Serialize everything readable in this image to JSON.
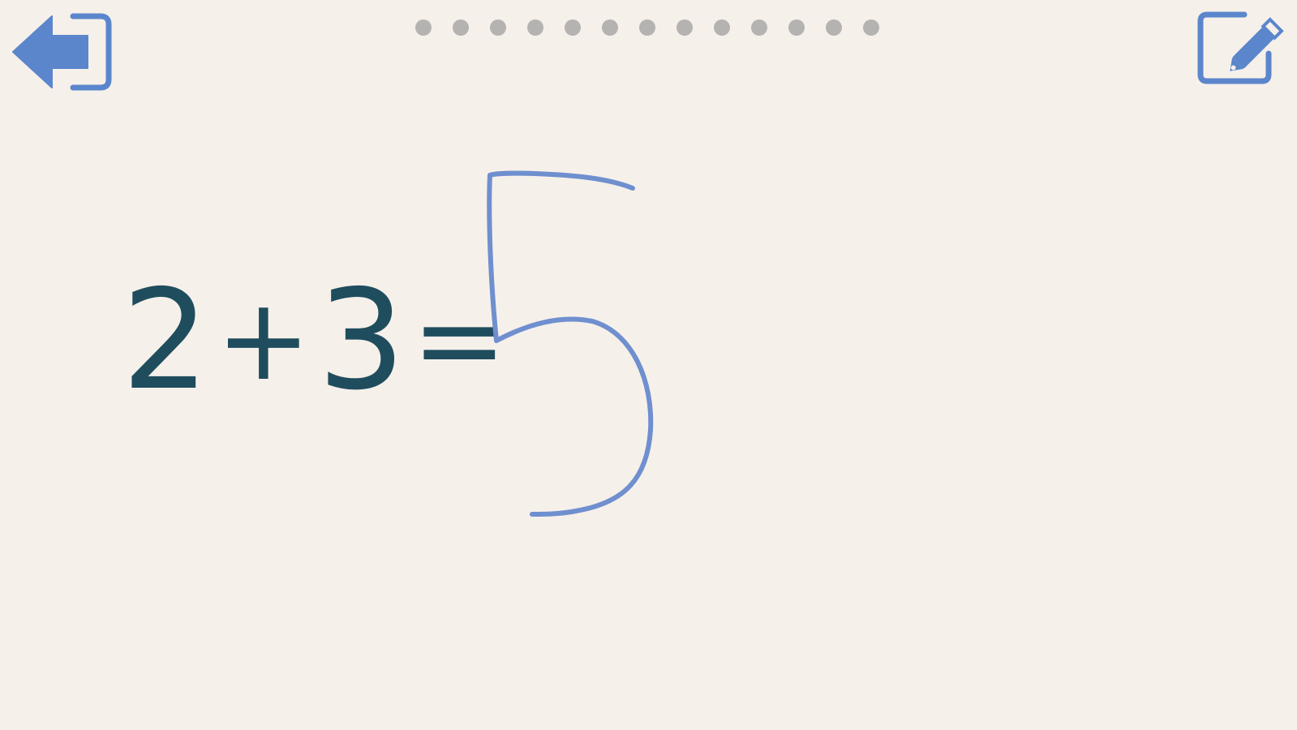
{
  "toolbar": {
    "exit_icon": "exit-arrow-icon",
    "edit_icon": "pencil-edit-icon",
    "accent_color": "#5b86cc"
  },
  "progress": {
    "total": 13,
    "current": 0,
    "dot_color": "#b5b3b1"
  },
  "problem": {
    "a": "2",
    "op": "+",
    "b": "3",
    "eq": "=",
    "text_color": "#1f4d5e"
  },
  "answer": {
    "value": "5",
    "ink_color": "#6f8fcf"
  }
}
